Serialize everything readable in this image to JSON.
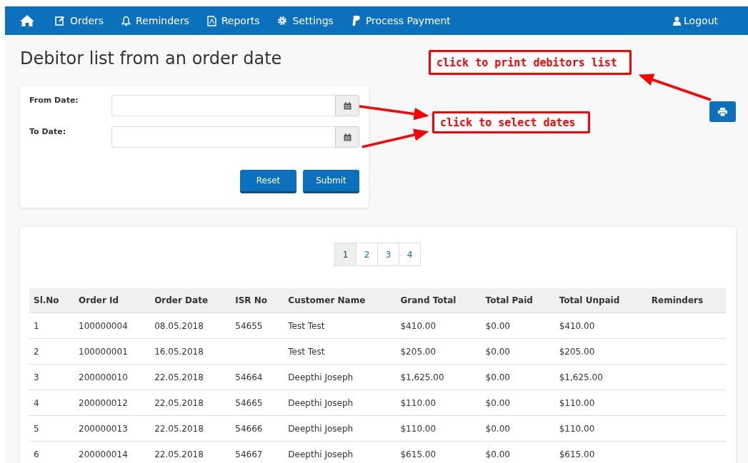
{
  "nav": {
    "items": [
      "Orders",
      "Reminders",
      "Reports",
      "Settings",
      "Process Payment"
    ],
    "logout": "Logout"
  },
  "title": "Debitor list from an order date",
  "filter": {
    "fields": [
      {
        "label": "From Date:"
      },
      {
        "label": "To Date:"
      }
    ],
    "buttons": [
      "Reset",
      "Submit"
    ]
  },
  "pagination": [
    {
      "label": "1",
      "selected": true
    },
    {
      "label": "2",
      "selected": false
    },
    {
      "label": "3",
      "selected": false
    },
    {
      "label": "4",
      "selected": false
    }
  ],
  "table": {
    "columns": [
      "Sl.No",
      "Order Id",
      "Order Date",
      "ISR No",
      "Customer Name",
      "Grand Total",
      "Total Paid",
      "Total Unpaid",
      "Reminders"
    ],
    "rows": [
      [
        "1",
        "100000004",
        "08.05.2018",
        "54655",
        "Test Test",
        "$410.00",
        "$0.00",
        "$410.00",
        ""
      ],
      [
        "2",
        "100000001",
        "16.05.2018",
        "",
        "Test Test",
        "$205.00",
        "$0.00",
        "$205.00",
        ""
      ],
      [
        "3",
        "200000010",
        "22.05.2018",
        "54664",
        "Deepthi Joseph",
        "$1,625.00",
        "$0.00",
        "$1,625.00",
        ""
      ],
      [
        "4",
        "200000012",
        "22.05.2018",
        "54665",
        "Deepthi Joseph",
        "$110.00",
        "$0.00",
        "$110.00",
        ""
      ],
      [
        "5",
        "200000013",
        "22.05.2018",
        "54666",
        "Deepthi Joseph",
        "$110.00",
        "$0.00",
        "$110.00",
        ""
      ],
      [
        "6",
        "200000014",
        "22.05.2018",
        "54667",
        "Deepthi Joseph",
        "$615.00",
        "$0.00",
        "$615.00",
        ""
      ]
    ]
  },
  "annotations": [
    {
      "text": "click to print debitors list"
    },
    {
      "text": "click to select dates"
    }
  ]
}
